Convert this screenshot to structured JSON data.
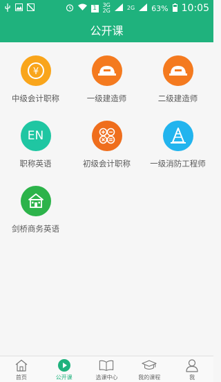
{
  "status_bar": {
    "battery": "63%",
    "time": "10:05",
    "network1": "3G",
    "network2": "2G",
    "network3": "2G",
    "sim_badge": "1",
    "icons": [
      "usb-icon",
      "image-icon",
      "no-sim-icon",
      "alarm-icon",
      "wifi-icon",
      "signal-icon",
      "battery-icon"
    ]
  },
  "header": {
    "title": "公开课"
  },
  "courses": [
    {
      "label": "中级会计职称",
      "icon": "yen-icon",
      "color": "#f9a51b",
      "glyph": "¥"
    },
    {
      "label": "一级建造师",
      "icon": "hardhat-icon",
      "color": "#f47a1f",
      "glyph": ""
    },
    {
      "label": "二级建造师",
      "icon": "hardhat-icon",
      "color": "#f47a1f",
      "glyph": ""
    },
    {
      "label": "职称英语",
      "icon": "en-icon",
      "color": "#1fc6a2",
      "glyph": "EN"
    },
    {
      "label": "初级会计职称",
      "icon": "calculator-icon",
      "color": "#ef6e1d",
      "glyph": ""
    },
    {
      "label": "一级消防工程师",
      "icon": "cone-icon",
      "color": "#22b4ee",
      "glyph": ""
    },
    {
      "label": "剑桥商务英语",
      "icon": "building-icon",
      "color": "#2cb34a",
      "glyph": ""
    }
  ],
  "bottom_nav": [
    {
      "label": "首页",
      "icon": "home-icon",
      "active": false
    },
    {
      "label": "公开课",
      "icon": "play-icon",
      "active": true
    },
    {
      "label": "选课中心",
      "icon": "book-icon",
      "active": false
    },
    {
      "label": "我的课程",
      "icon": "graduation-cap-icon",
      "active": false
    },
    {
      "label": "我",
      "icon": "user-icon",
      "active": false
    }
  ],
  "colors": {
    "brand": "#1fb27d",
    "background": "#f6f6f6",
    "label": "#5a5a5a"
  }
}
